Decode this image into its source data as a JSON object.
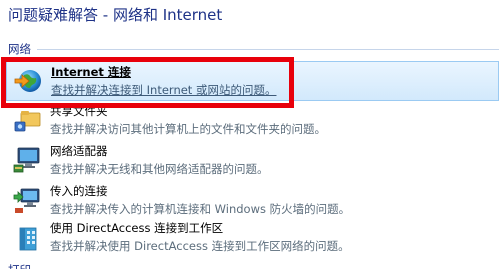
{
  "page": {
    "title": "问题疑难解答 - 网络和 Internet"
  },
  "group": {
    "label": "网络"
  },
  "items": [
    {
      "title": "Internet 连接",
      "desc": "查找并解决连接到 Internet 或网站的问题。",
      "icon": "internet-globe-icon",
      "selected": true
    },
    {
      "title": "共享文件夹",
      "desc": "查找并解决访问其他计算机上的文件和文件夹的问题。",
      "icon": "shared-folder-icon",
      "selected": false
    },
    {
      "title": "网络适配器",
      "desc": "查找并解决无线和其他网络适配器的问题。",
      "icon": "network-adapter-icon",
      "selected": false
    },
    {
      "title": "传入的连接",
      "desc": "查找并解决传入的计算机连接和 Windows 防火墙的问题。",
      "icon": "incoming-connection-icon",
      "selected": false
    },
    {
      "title": "使用 DirectAccess 连接到工作区",
      "desc": "查找并解决使用 DirectAccess 连接到工作区网络的问题。",
      "icon": "directaccess-building-icon",
      "selected": false
    }
  ],
  "next_group": {
    "label": "打印"
  },
  "colors": {
    "title": "#1e3287",
    "highlight": "#e8000b",
    "selected_bg": "#d2e9fc"
  }
}
